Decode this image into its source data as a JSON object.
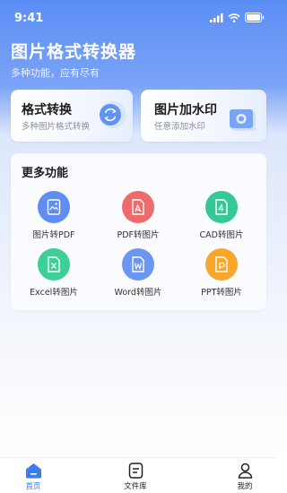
{
  "status": {
    "time": "9:41"
  },
  "header": {
    "title": "图片格式转换器",
    "subtitle": "多种功能，应有尽有"
  },
  "cards": [
    {
      "title": "格式转换",
      "desc": "多种图片格式转换",
      "icon": "convert-icon"
    },
    {
      "title": "图片加水印",
      "desc": "任意添加水印",
      "icon": "camera-icon"
    }
  ],
  "more": {
    "title": "更多功能",
    "items": [
      {
        "label": "图片转PDF",
        "icon": "image-file-icon",
        "color": "#5f8df0"
      },
      {
        "label": "PDF转图片",
        "icon": "pdf-file-icon",
        "color": "#ef6b6b"
      },
      {
        "label": "CAD转图片",
        "icon": "cad-file-icon",
        "color": "#36c796"
      },
      {
        "label": "Excel转图片",
        "icon": "excel-file-icon",
        "color": "#3ecf98"
      },
      {
        "label": "Word转图片",
        "icon": "word-file-icon",
        "color": "#6b97f2"
      },
      {
        "label": "PPT转图片",
        "icon": "ppt-file-icon",
        "color": "#f7a72b"
      }
    ]
  },
  "nav": {
    "items": [
      {
        "label": "首页",
        "icon": "home-icon",
        "active": true
      },
      {
        "label": "文件库",
        "icon": "file-library-icon",
        "active": false
      },
      {
        "label": "我的",
        "icon": "profile-icon",
        "active": false
      }
    ],
    "active_color": "#3b7cf0"
  }
}
